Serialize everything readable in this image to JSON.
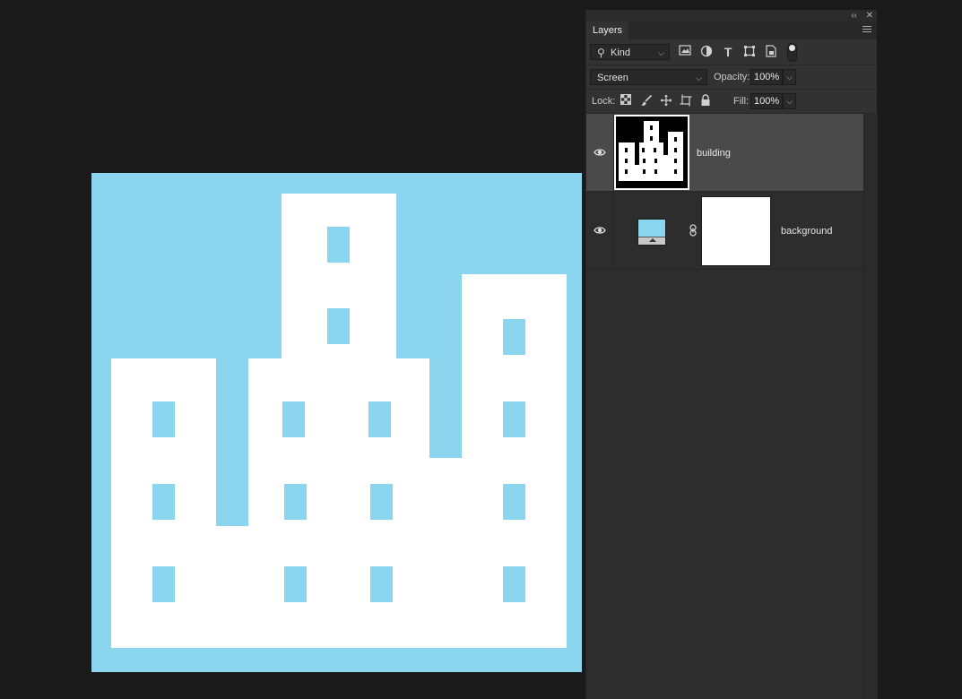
{
  "panel": {
    "title": "Layers",
    "collapse_glyph": "‹‹",
    "close_glyph": "✕",
    "filter": {
      "kind_label": "Kind",
      "search_glyph": "⚲"
    },
    "blend_mode": "Screen",
    "opacity_label": "Opacity:",
    "opacity_value": "100%",
    "lock_label": "Lock:",
    "fill_label": "Fill:",
    "fill_value": "100%",
    "icons": {
      "filter_pixel": "image-filter-icon",
      "filter_adjust": "adjustment-filter-icon",
      "filter_type": "type-filter-icon",
      "filter_shape": "shape-filter-icon",
      "filter_smart": "smart-object-filter-icon",
      "filter_toggle": "filter-toggle-icon",
      "lock_transparent": "lock-transparent-pixels-icon",
      "lock_image": "lock-image-pixels-icon",
      "lock_position": "lock-position-icon",
      "lock_artboard": "lock-artboard-icon",
      "lock_all": "lock-all-icon"
    },
    "layers": [
      {
        "name": "building",
        "selected": true,
        "visible": true
      },
      {
        "name": "background",
        "selected": false,
        "visible": true
      }
    ]
  },
  "colors": {
    "canvas_fill": "#8bd5ef",
    "building": "#ffffff",
    "app_bg": "#1a1a1a",
    "panel_bg": "#323232",
    "selected_layer": "#4a4a4a"
  }
}
